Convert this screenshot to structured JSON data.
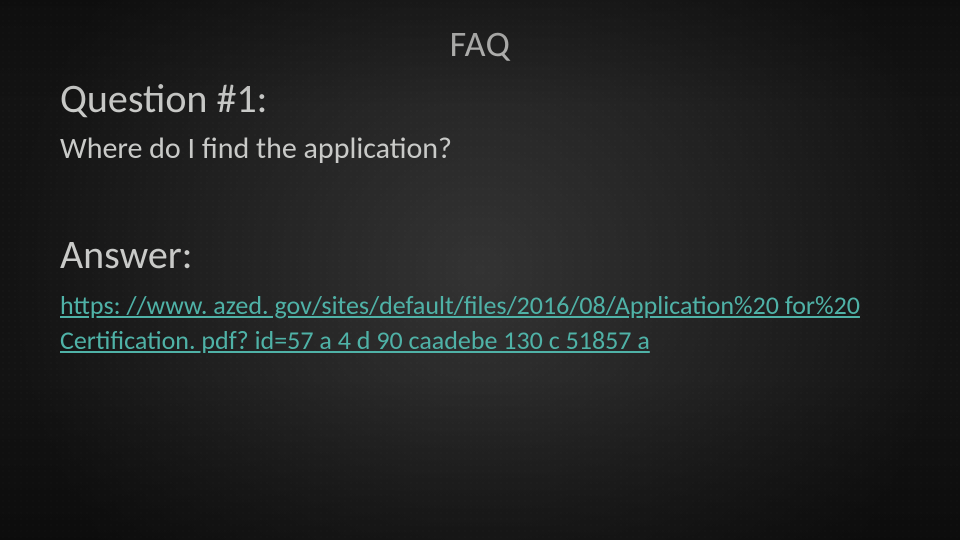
{
  "title": "FAQ",
  "question": {
    "heading": "Question #1:",
    "text": "Where do I find the application?"
  },
  "answer": {
    "heading": "Answer:",
    "link_text": "https: //www. azed. gov/sites/default/files/2016/08/Application%20 for%20 Certification. pdf? id=57 a 4 d 90 caadebe 130 c 51857 a"
  }
}
